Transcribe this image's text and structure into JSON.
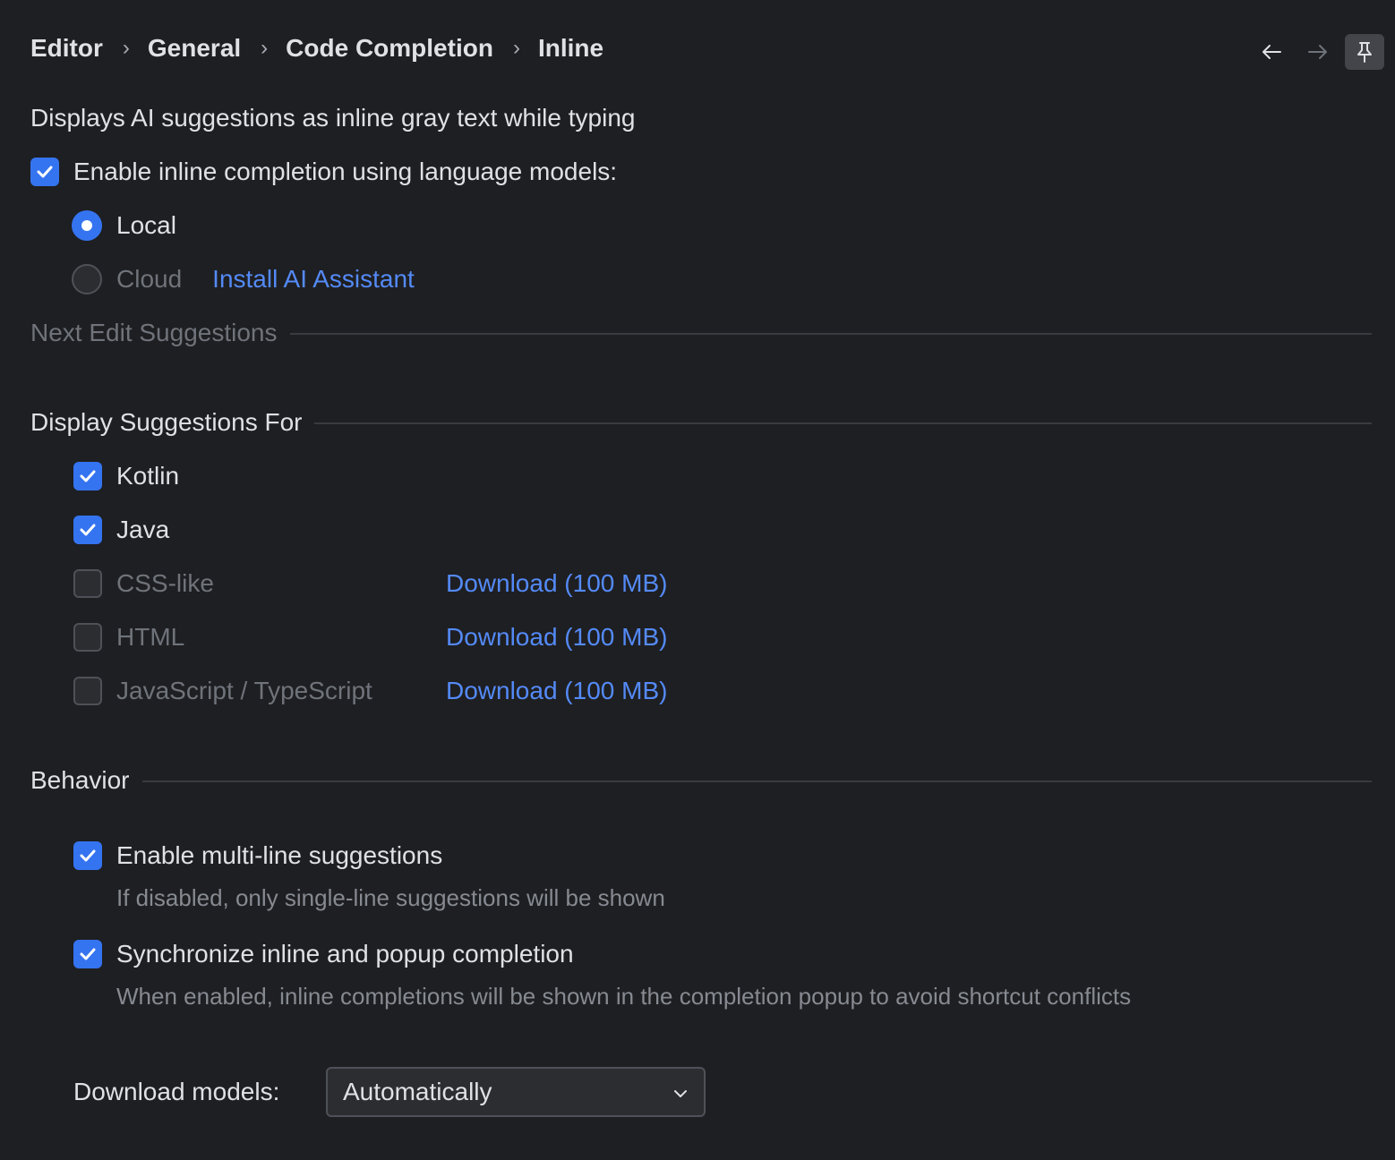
{
  "breadcrumb": {
    "items": [
      "Editor",
      "General",
      "Code Completion",
      "Inline"
    ],
    "separator": "›"
  },
  "nav": {
    "back_icon": "arrow-left-icon",
    "forward_icon": "arrow-right-icon",
    "pin_icon": "pin-icon"
  },
  "description": "Displays AI suggestions as inline gray text while typing",
  "enable_inline": {
    "label": "Enable inline completion using language models:",
    "checked": true
  },
  "model_source": {
    "local_label": "Local",
    "cloud_label": "Cloud",
    "selected": "Local",
    "install_link": "Install AI Assistant"
  },
  "sections": {
    "next_edit": "Next Edit Suggestions",
    "display_for": "Display Suggestions For",
    "behavior": "Behavior"
  },
  "languages": [
    {
      "label": "Kotlin",
      "checked": true,
      "enabled": true,
      "download": ""
    },
    {
      "label": "Java",
      "checked": true,
      "enabled": true,
      "download": ""
    },
    {
      "label": "CSS-like",
      "checked": false,
      "enabled": false,
      "download": "Download (100 MB)"
    },
    {
      "label": "HTML",
      "checked": false,
      "enabled": false,
      "download": "Download (100 MB)"
    },
    {
      "label": "JavaScript / TypeScript",
      "checked": false,
      "enabled": false,
      "download": "Download (100 MB)"
    }
  ],
  "behavior": {
    "multiline": {
      "label": "Enable multi-line suggestions",
      "hint": "If disabled, only single-line suggestions will be shown",
      "checked": true
    },
    "sync": {
      "label": "Synchronize inline and popup completion",
      "hint": "When enabled, inline completions will be shown in the completion popup to avoid shortcut conflicts",
      "checked": true
    }
  },
  "download_models": {
    "label": "Download models:",
    "value": "Automatically"
  },
  "colors": {
    "background": "#1e1f22",
    "accent": "#3574f0",
    "link": "#548af7",
    "text": "#dfe1e5",
    "disabled_text": "#6f737a"
  }
}
